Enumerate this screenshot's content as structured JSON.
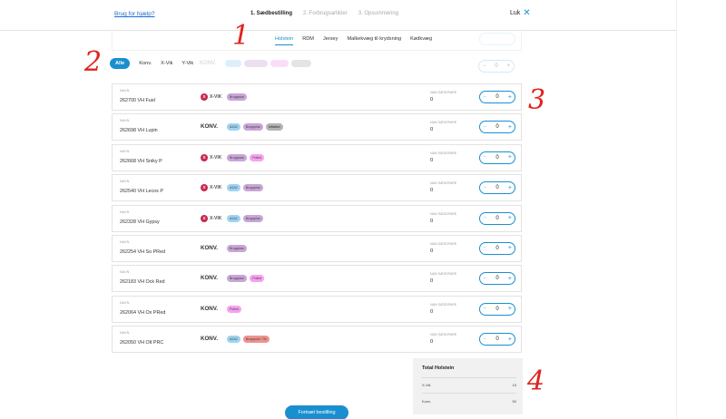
{
  "header": {
    "help_link": "Brug for hjælp?",
    "steps": [
      "1. Sædbestilling",
      "2. Forbrugsartikler",
      "3. Opsummering"
    ],
    "close_label": "Luk",
    "close_icon": "close-x-icon"
  },
  "category_tabs": [
    "Holstein",
    "RDM",
    "Jersey",
    "Malkekvæg til krydsning",
    "Kødkvæg"
  ],
  "active_category": "Holstein",
  "filters": [
    "Alle",
    "Konv.",
    "X-Vik",
    "Y-Vik"
  ],
  "active_filter": "Alle",
  "ghost_row": {
    "type": "KONV.",
    "qval": "0"
  },
  "products": [
    {
      "small": "NAVN",
      "name": "262700 VH Fuel",
      "type": "X-VIK",
      "type_kind": "xvik",
      "tags": [
        {
          "label": "Brugsplan",
          "color": "purple"
        }
      ],
      "qlabel": "NAN SÆDSPARE",
      "qval": "0",
      "qty": "0"
    },
    {
      "small": "NAVN",
      "name": "262698 VH Lupin",
      "type": "KONV.",
      "type_kind": "konv",
      "tags": [
        {
          "label": "A2A2",
          "color": "blue"
        },
        {
          "label": "Brugsplan",
          "color": "purple"
        },
        {
          "label": "Inflation",
          "color": "grey"
        }
      ],
      "qlabel": "NAN SÆDSPARE",
      "qval": "0",
      "qty": "0"
    },
    {
      "small": "NAVN",
      "name": "262668 VH Sniky P",
      "type": "X-VIK",
      "type_kind": "xvik",
      "tags": [
        {
          "label": "Brugsplan",
          "color": "purple"
        },
        {
          "label": "Polled",
          "color": "pink"
        }
      ],
      "qlabel": "NAN SÆDSPARE",
      "qval": "0",
      "qty": "0"
    },
    {
      "small": "NAVN",
      "name": "262540 VH Lecos P",
      "type": "X-VIK",
      "type_kind": "xvik",
      "tags": [
        {
          "label": "A2A2",
          "color": "blue"
        },
        {
          "label": "Brugsplan",
          "color": "purple"
        }
      ],
      "qlabel": "NAN SÆDSPARE",
      "qval": "0",
      "qty": "0"
    },
    {
      "small": "NAVN",
      "name": "262328 VH Gypsy",
      "type": "X-VIK",
      "type_kind": "xvik",
      "tags": [
        {
          "label": "A2A2",
          "color": "blue"
        },
        {
          "label": "Brugsplan",
          "color": "purple"
        }
      ],
      "qlabel": "NAN SÆDSPARE",
      "qval": "0",
      "qty": "0"
    },
    {
      "small": "NAVN",
      "name": "262254 VH So PRed",
      "type": "KONV.",
      "type_kind": "konv",
      "tags": [
        {
          "label": "Brugsplan",
          "color": "purple"
        }
      ],
      "qlabel": "NAN SÆDSPARE",
      "qval": "0",
      "qty": "0"
    },
    {
      "small": "NAVN",
      "name": "262183 VH Ock Red",
      "type": "KONV.",
      "type_kind": "konv",
      "tags": [
        {
          "label": "Brugsplan",
          "color": "purple"
        },
        {
          "label": "Polled",
          "color": "pink"
        }
      ],
      "qlabel": "NAN SÆDSPARE",
      "qval": "0",
      "qty": "0"
    },
    {
      "small": "NAVN",
      "name": "262064 VH Ox PRed",
      "type": "KONV.",
      "type_kind": "konv",
      "tags": [
        {
          "label": "Polled",
          "color": "pink"
        }
      ],
      "qlabel": "NAN SÆDSPARE",
      "qval": "0",
      "qty": "0"
    },
    {
      "small": "NAVN",
      "name": "262050 VH Olt PRC",
      "type": "KONV.",
      "type_kind": "konv",
      "tags": [
        {
          "label": "A2A2",
          "color": "blue"
        },
        {
          "label": "Brugsplan 73h",
          "color": "red"
        }
      ],
      "qlabel": "NAN SÆDSPARE",
      "qval": "0",
      "qty": "0"
    }
  ],
  "total": {
    "title": "Total Holstein",
    "rows": [
      {
        "label": "X-Vik",
        "value": "15"
      },
      {
        "label": "Konv.",
        "value": "50"
      }
    ]
  },
  "cta_label": "Fortsæt bestilling",
  "annotations": [
    "1",
    "2",
    "3",
    "4"
  ],
  "colors": {
    "accent": "#1a8fd0",
    "annotation": "#e0231f"
  }
}
